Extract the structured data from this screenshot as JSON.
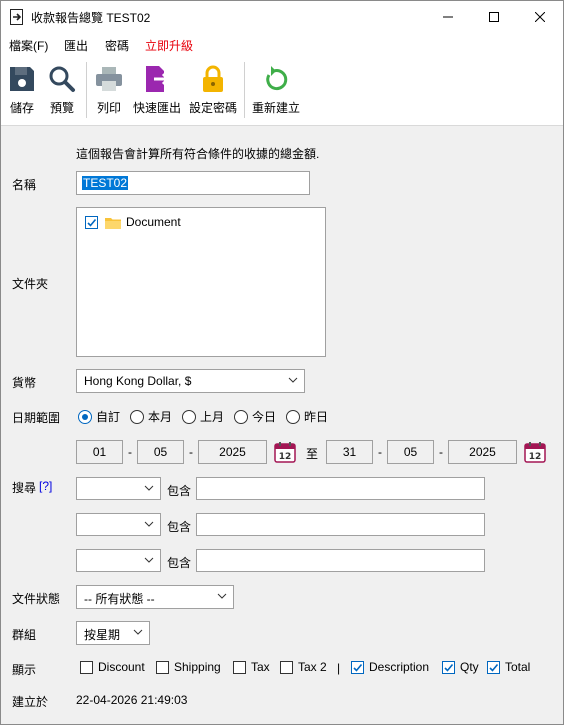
{
  "window": {
    "title": "收款報告總覽 TEST02"
  },
  "menu": {
    "file": "檔案(F)",
    "export": "匯出",
    "password": "密碼",
    "upgrade": "立即升級"
  },
  "toolbar": {
    "save": "儲存",
    "preview": "預覽",
    "print": "列印",
    "quick_export": "快速匯出",
    "set_password": "設定密碼",
    "rebuild": "重新建立"
  },
  "form": {
    "description": "這個報告會計算所有符合條件的收據的總金額.",
    "name_label": "名稱",
    "name_value": "TEST02",
    "folder_label": "文件夾",
    "folder_item": "Document",
    "currency_label": "貨幣",
    "currency_value": "Hong Kong Dollar, $",
    "date_range_label": "日期範圍",
    "date_options": [
      "自訂",
      "本月",
      "上月",
      "今日",
      "昨日"
    ],
    "date_from": {
      "day": "01",
      "month": "05",
      "year": "2025"
    },
    "date_to_label": "至",
    "date_to": {
      "day": "31",
      "month": "05",
      "year": "2025"
    },
    "date_sep": "-",
    "search_label": "搜尋",
    "search_help": "[?]",
    "contains_label": "包含",
    "doc_status_label": "文件狀態",
    "doc_status_value": "-- 所有狀態 --",
    "group_label": "群組",
    "group_value": "按星期",
    "display_label": "顯示",
    "display_options": [
      {
        "label": "Discount",
        "checked": false
      },
      {
        "label": "Shipping",
        "checked": false
      },
      {
        "label": "Tax",
        "checked": false
      },
      {
        "label": "Tax 2",
        "checked": false
      },
      {
        "label": "Description",
        "checked": true
      },
      {
        "label": "Qty",
        "checked": true
      },
      {
        "label": "Total",
        "checked": true
      }
    ],
    "display_divider": "|",
    "created_label": "建立於",
    "created_value": "22-04-2026 21:49:03"
  },
  "colors": {
    "accent": "#0067c0",
    "upgrade": "#e8000b",
    "selection": "#0078d7"
  }
}
